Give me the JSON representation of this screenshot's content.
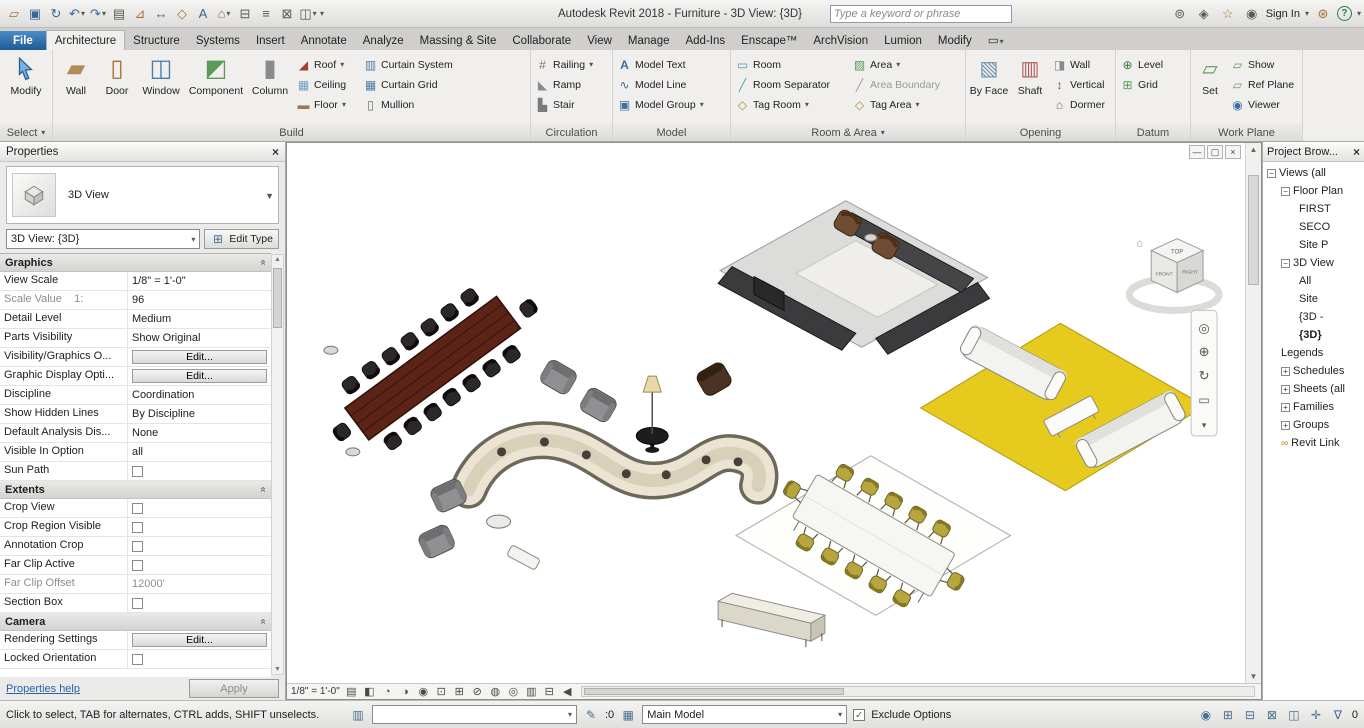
{
  "colors": {
    "accent_blue": "#1e5c9a",
    "mat_yellow": "#e6ca1d",
    "table_wood": "#5c2317"
  },
  "titlebar": {
    "title": "Autodesk Revit 2018 -   Furniture - 3D View: {3D}",
    "search_placeholder": "Type a keyword or phrase",
    "sign_in": "Sign In"
  },
  "tabs": {
    "file": "File",
    "items": [
      "Architecture",
      "Structure",
      "Systems",
      "Insert",
      "Annotate",
      "Analyze",
      "Massing & Site",
      "Collaborate",
      "View",
      "Manage",
      "Add-Ins",
      "Enscape™",
      "ArchVision",
      "Lumion",
      "Modify"
    ]
  },
  "ribbon": {
    "modify": "Modify",
    "select_label": "Select",
    "wall": "Wall",
    "door": "Door",
    "window": "Window",
    "component": "Component",
    "column": "Column",
    "roof": "Roof",
    "ceiling": "Ceiling",
    "floor": "Floor",
    "curtain_system": "Curtain System",
    "curtain_grid": "Curtain Grid",
    "mullion": "Mullion",
    "build_label": "Build",
    "railing": "Railing",
    "ramp": "Ramp",
    "stair": "Stair",
    "circulation_label": "Circulation",
    "model_text": "Model Text",
    "model_line": "Model Line",
    "model_group": "Model Group",
    "model_label": "Model",
    "room": "Room",
    "room_separator": "Room Separator",
    "tag_room": "Tag Room",
    "area": "Area",
    "area_boundary": "Area Boundary",
    "tag_area": "Tag Area",
    "room_area_label": "Room & Area",
    "by_face": "By Face",
    "shaft": "Shaft",
    "opening_wall": "Wall",
    "vertical": "Vertical",
    "dormer": "Dormer",
    "opening_label": "Opening",
    "level": "Level",
    "grid": "Grid",
    "datum_label": "Datum",
    "set": "Set",
    "show": "Show",
    "ref_plane": "Ref Plane",
    "viewer": "Viewer",
    "workplane_label": "Work Plane"
  },
  "properties": {
    "title": "Properties",
    "type_name": "3D View",
    "selector": "3D View: {3D}",
    "edit_type": "Edit Type",
    "sections": {
      "graphics": "Graphics",
      "extents": "Extents",
      "camera": "Camera"
    },
    "rows": {
      "view_scale": {
        "label": "View Scale",
        "value": "1/8\" = 1'-0\""
      },
      "scale_value": {
        "label": "Scale Value    1:",
        "value": "96"
      },
      "detail_level": {
        "label": "Detail Level",
        "value": "Medium"
      },
      "parts_visibility": {
        "label": "Parts Visibility",
        "value": "Show Original"
      },
      "vis_graphics": {
        "label": "Visibility/Graphics O...",
        "value": "Edit..."
      },
      "graphic_display": {
        "label": "Graphic Display Opti...",
        "value": "Edit..."
      },
      "discipline": {
        "label": "Discipline",
        "value": "Coordination"
      },
      "show_hidden": {
        "label": "Show Hidden Lines",
        "value": "By Discipline"
      },
      "default_analysis": {
        "label": "Default Analysis Dis...",
        "value": "None"
      },
      "visible_in_option": {
        "label": "Visible In Option",
        "value": "all"
      },
      "sun_path": {
        "label": "Sun Path"
      },
      "crop_view": {
        "label": "Crop View"
      },
      "crop_region": {
        "label": "Crop Region Visible"
      },
      "annotation_crop": {
        "label": "Annotation Crop"
      },
      "far_clip_active": {
        "label": "Far Clip Active"
      },
      "far_clip_offset": {
        "label": "Far Clip Offset",
        "value": "12000'"
      },
      "section_box": {
        "label": "Section Box"
      },
      "rendering_settings": {
        "label": "Rendering Settings",
        "value": "Edit..."
      },
      "locked_orientation": {
        "label": "Locked Orientation"
      }
    },
    "apply": "Apply",
    "help": "Properties help"
  },
  "viewport": {
    "scale": "1/8\" = 1'-0\"",
    "viewcube": {
      "top": "TOP",
      "front": "FRONT",
      "right": "RIGHT"
    }
  },
  "browser": {
    "title": "Project Brow...",
    "items": [
      "Views (all",
      "Floor Plan",
      "FIRST",
      "SECO",
      "Site P",
      "3D View",
      "All",
      "Site",
      "{3D -",
      "{3D}",
      "Legends",
      "Schedules",
      "Sheets (all",
      "Families",
      "Groups",
      "Revit Link"
    ]
  },
  "statusbar": {
    "hint": "Click to select, TAB for alternates, CTRL adds, SHIFT unselects.",
    "editable_count": ":0",
    "main_model": "Main Model",
    "exclude_options": "Exclude Options",
    "filter_count": "0"
  }
}
